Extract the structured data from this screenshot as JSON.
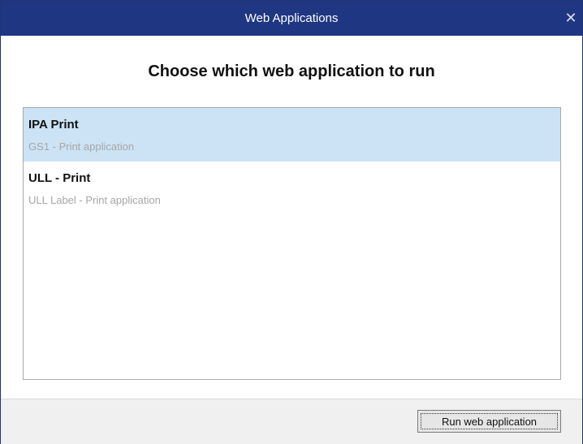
{
  "window": {
    "title": "Web Applications",
    "close_glyph": "✕",
    "close_icon": "close-icon"
  },
  "heading": "Choose which web application to run",
  "applications": [
    {
      "name": "IPA Print",
      "description": "GS1 - Print application",
      "selected": true
    },
    {
      "name": "ULL - Print",
      "description": "ULL Label - Print application",
      "selected": false
    }
  ],
  "footer": {
    "run_label": "Run web application"
  },
  "colors": {
    "titlebar": "#1f3782",
    "selection": "#cce3f5",
    "description_text": "#a6a6a6"
  }
}
